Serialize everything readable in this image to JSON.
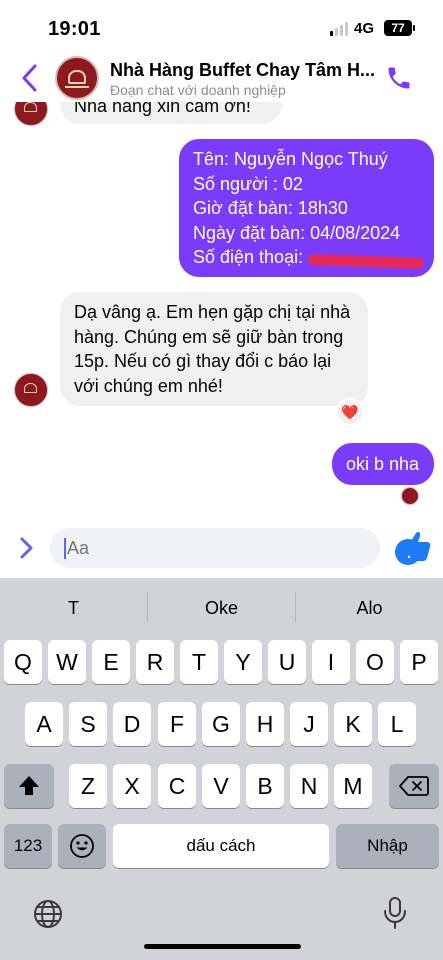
{
  "status_bar": {
    "time": "19:01",
    "network": "4G",
    "battery": "77"
  },
  "header": {
    "title": "Nhà Hàng Buffet Chay Tâm H...",
    "subtitle": "Đoạn chat với doanh nghiệp",
    "icons": [
      "chevron-left-icon",
      "call-icon"
    ],
    "accent_color": "#7a3bfa"
  },
  "messages": {
    "prev_incoming": "Nhà hàng xin cảm ơn!",
    "outgoing_booking": {
      "line1": "Tên: Nguyễn Ngọc Thuý",
      "line2": "Số người : 02",
      "line3": "Giờ đặt bàn: 18h30",
      "line4": "Ngày đặt bàn: 04/08/2024",
      "line5": "Số điện thoại: "
    },
    "incoming_reply": {
      "line1": "Dạ vâng ạ. Em hẹn gặp chị tại nhà",
      "line2": "hàng. Chúng em sẽ giữ bàn trong",
      "line3": "15p. Nếu có gì thay đổi c báo lại",
      "line4": "với chúng em nhé!"
    },
    "reaction": "❤️",
    "outgoing_short": "oki b nha"
  },
  "composer": {
    "placeholder": "Aa",
    "icons": [
      "chevron-right-icon",
      "emoji-icon",
      "like-icon"
    ]
  },
  "keyboard": {
    "suggestions": [
      "T",
      "Oke",
      "Alo"
    ],
    "row1": [
      "Q",
      "W",
      "E",
      "R",
      "T",
      "Y",
      "U",
      "I",
      "O",
      "P"
    ],
    "row2": [
      "A",
      "S",
      "D",
      "F",
      "G",
      "H",
      "J",
      "K",
      "L"
    ],
    "row3": [
      "Z",
      "X",
      "C",
      "V",
      "B",
      "N",
      "M"
    ],
    "numbers_label": "123",
    "space_label": "dấu cách",
    "return_label": "Nhập",
    "icons": [
      "shift-icon",
      "backspace-icon",
      "emoji-icon",
      "globe-icon",
      "microphone-icon"
    ]
  }
}
